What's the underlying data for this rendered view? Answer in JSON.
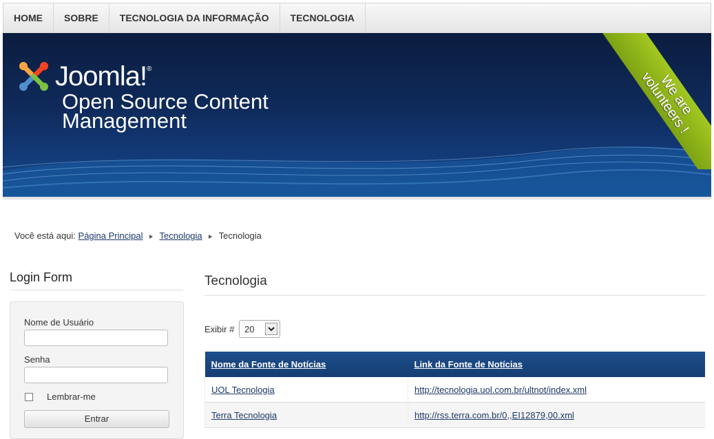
{
  "nav": {
    "items": [
      {
        "label": "HOME"
      },
      {
        "label": "SOBRE"
      },
      {
        "label": "TECNOLOGIA DA INFORMAÇÃO"
      },
      {
        "label": "TECNOLOGIA"
      }
    ]
  },
  "banner": {
    "logo_text": "Joomla!",
    "logo_mark": "®",
    "tagline": "Open Source Content Management",
    "ribbon": "We are volunteers !",
    "colors": {
      "ribbon": "#8ab51a",
      "banner": "#0f2a5a"
    }
  },
  "breadcrumb": {
    "prefix": "Você está aqui:",
    "items": [
      {
        "label": "Página Principal"
      },
      {
        "label": "Tecnologia"
      }
    ],
    "current": "Tecnologia"
  },
  "login": {
    "title": "Login Form",
    "username_label": "Nome de Usuário",
    "username_value": "",
    "password_label": "Senha",
    "password_value": "",
    "remember_label": "Lembrar-me",
    "submit_label": "Entrar"
  },
  "main": {
    "heading": "Tecnologia",
    "display_label": "Exibir #",
    "display_value": "20",
    "table": {
      "headers": [
        "Nome da Fonte de Notícias",
        "Link da Fonte de Notícias"
      ],
      "rows": [
        {
          "name": "UOL Tecnologia",
          "link": "http://tecnologia.uol.com.br/ultnot/index.xml"
        },
        {
          "name": "Terra Tecnologia",
          "link": "http://rss.terra.com.br/0,,EI12879,00.xml"
        }
      ]
    }
  }
}
